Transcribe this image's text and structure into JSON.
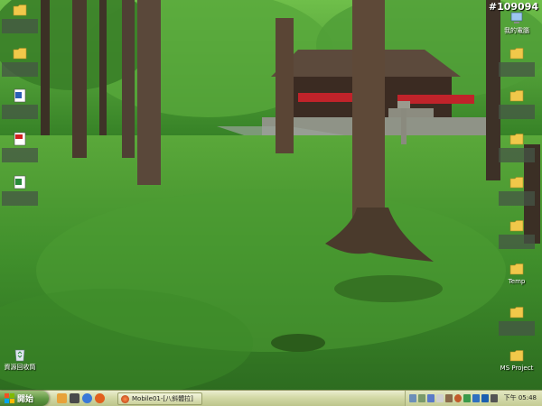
{
  "watermark": "#109094",
  "desktop_left": [
    {
      "name": "folder-icon",
      "label": "",
      "blurred": true
    },
    {
      "name": "folder-icon",
      "label": "",
      "blurred": true
    },
    {
      "name": "word-document-icon",
      "label": "",
      "blurred": true
    },
    {
      "name": "pdf-document-icon",
      "label": "",
      "blurred": true
    },
    {
      "name": "excel-document-icon",
      "label": "",
      "blurred": true
    },
    {
      "name": "recycle-bin-icon",
      "label": "資源回收筒",
      "blurred": false
    }
  ],
  "desktop_right": [
    {
      "name": "my-computer-icon",
      "label": "我的電腦",
      "blurred": false
    },
    {
      "name": "folder-icon",
      "label": "",
      "blurred": true
    },
    {
      "name": "folder-icon",
      "label": "",
      "blurred": true
    },
    {
      "name": "folder-icon",
      "label": "",
      "blurred": true
    },
    {
      "name": "folder-icon",
      "label": "",
      "blurred": true
    },
    {
      "name": "folder-icon",
      "label": "",
      "blurred": true
    },
    {
      "name": "folder-icon",
      "label": "",
      "blurred": true
    },
    {
      "name": "temp-folder-icon",
      "label": "Temp",
      "blurred": false
    },
    {
      "name": "folder-icon",
      "label": "",
      "blurred": true
    },
    {
      "name": "ms-project-folder-icon",
      "label": "MS Project",
      "blurred": false
    }
  ],
  "taskbar": {
    "start_label": "開始",
    "quick_launch": [
      "desktop-icon",
      "media-player-icon",
      "ie-icon",
      "firefox-icon"
    ],
    "task_item_label": "Mobile01-[八斜體拉]",
    "tray_icons": [
      "network-icon",
      "volume-icon",
      "language-icon",
      "ime-icon",
      "security-icon",
      "update-icon",
      "chat-icon",
      "antivirus-icon",
      "bluetooth-icon",
      "power-icon"
    ],
    "clock": "下午 05:48"
  },
  "colors": {
    "moss": "#3d8a2a",
    "canopy": "#4a9a35",
    "temple_red": "#c0232a",
    "taskbar": "#d3d9a6",
    "start_button": "#5f9742"
  }
}
